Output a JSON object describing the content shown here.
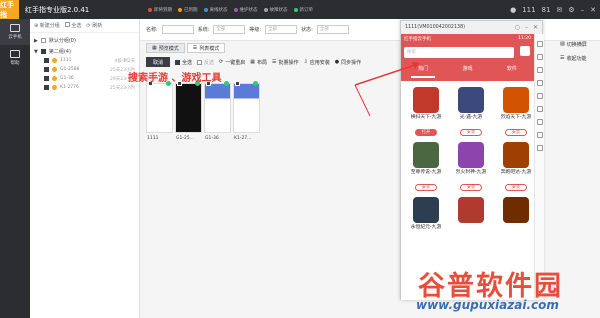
{
  "app": {
    "logo_text": "红手指",
    "title": "红手指专业版2.0.41"
  },
  "titlebar": {
    "status_tabs": [
      {
        "label": "即将到期",
        "color": "#e74c3c"
      },
      {
        "label": "已到期",
        "color": "#f39c12"
      },
      {
        "label": "离线状态",
        "color": "#3498db"
      },
      {
        "label": "维护状态",
        "color": "#9b59b6"
      },
      {
        "label": "故障状态",
        "color": "#95a5a6"
      },
      {
        "label": "新订单",
        "color": "#2ecc71"
      }
    ],
    "user": "111",
    "message_count": "81"
  },
  "rail": [
    {
      "label": "云手机",
      "icon": "phone-icon",
      "active": true
    },
    {
      "label": "帮助",
      "icon": "help-icon",
      "active": false
    }
  ],
  "device_panel": {
    "new_group": "新建分组",
    "select_all": "全选",
    "refresh": "刷新",
    "groups": [
      {
        "name": "默认分组(0)",
        "checked": false
      },
      {
        "name": "第二组(4)",
        "checked": true
      }
    ],
    "devices": [
      {
        "name": "1111",
        "res": "4核·剩2天"
      },
      {
        "name": "G1-2588",
        "res": "25天23小时"
      },
      {
        "name": "G1-36",
        "res": "29天23小时"
      },
      {
        "name": "K1-2776",
        "res": "25天23小时"
      }
    ]
  },
  "filter": {
    "name_label": "名称:",
    "name_value": "",
    "system_label": "系统:",
    "system_value": "全部",
    "level_label": "等级:",
    "level_value": "全部",
    "status_label": "状态:",
    "status_value": "全部"
  },
  "modes": {
    "preview": "预览模式",
    "list": "列表模式"
  },
  "toolbar": {
    "cancel": "取消",
    "select_all": "全选",
    "invert": "反选",
    "restart": "一键重启",
    "layout": "布局",
    "batch": "批量操作",
    "install": "应用安装",
    "sync": "同步操作"
  },
  "thumbs": [
    {
      "label": "1111",
      "style": "light"
    },
    {
      "label": "G1-25...",
      "style": "dark"
    },
    {
      "label": "G1-36",
      "style": "blue"
    },
    {
      "label": "K1-27...",
      "style": "blue"
    }
  ],
  "annotation": "搜索手游 、游戏工具",
  "right_tools": {
    "switch": "切换横屏",
    "collapse": "收起功能"
  },
  "phone": {
    "window_title": "1111(VM010042002138)",
    "app_name": "红手指云手机",
    "time": "11:20",
    "search_placeholder": "搜索",
    "tabs": [
      "热门",
      "游戏",
      "软件"
    ],
    "games": [
      {
        "name": "横扫天下-九游",
        "btn": "打开",
        "filled": true,
        "color": "#c0392b"
      },
      {
        "name": "光·遇-九游",
        "btn": "安装",
        "filled": false,
        "color": "#3b4a7a"
      },
      {
        "name": "烈焰天下-九游",
        "btn": "安装",
        "filled": false,
        "color": "#d35400"
      },
      {
        "name": "至尊传说-九游",
        "btn": "安装",
        "filled": false,
        "color": "#4a6741"
      },
      {
        "name": "烈火封神-九游",
        "btn": "安装",
        "filled": false,
        "color": "#8e44ad"
      },
      {
        "name": "奔跑吧达-九游",
        "btn": "安装",
        "filled": false,
        "color": "#a04000"
      },
      {
        "name": "永恒纪元-九游",
        "btn": "",
        "filled": false,
        "color": "#2c3e50"
      },
      {
        "name": "",
        "btn": "",
        "filled": false,
        "color": "#b03a2e"
      },
      {
        "name": "",
        "btn": "",
        "filled": false,
        "color": "#6e2c00"
      }
    ]
  },
  "watermark": {
    "cn": "谷普软件园",
    "url": "www.gupuxiazai.com"
  }
}
